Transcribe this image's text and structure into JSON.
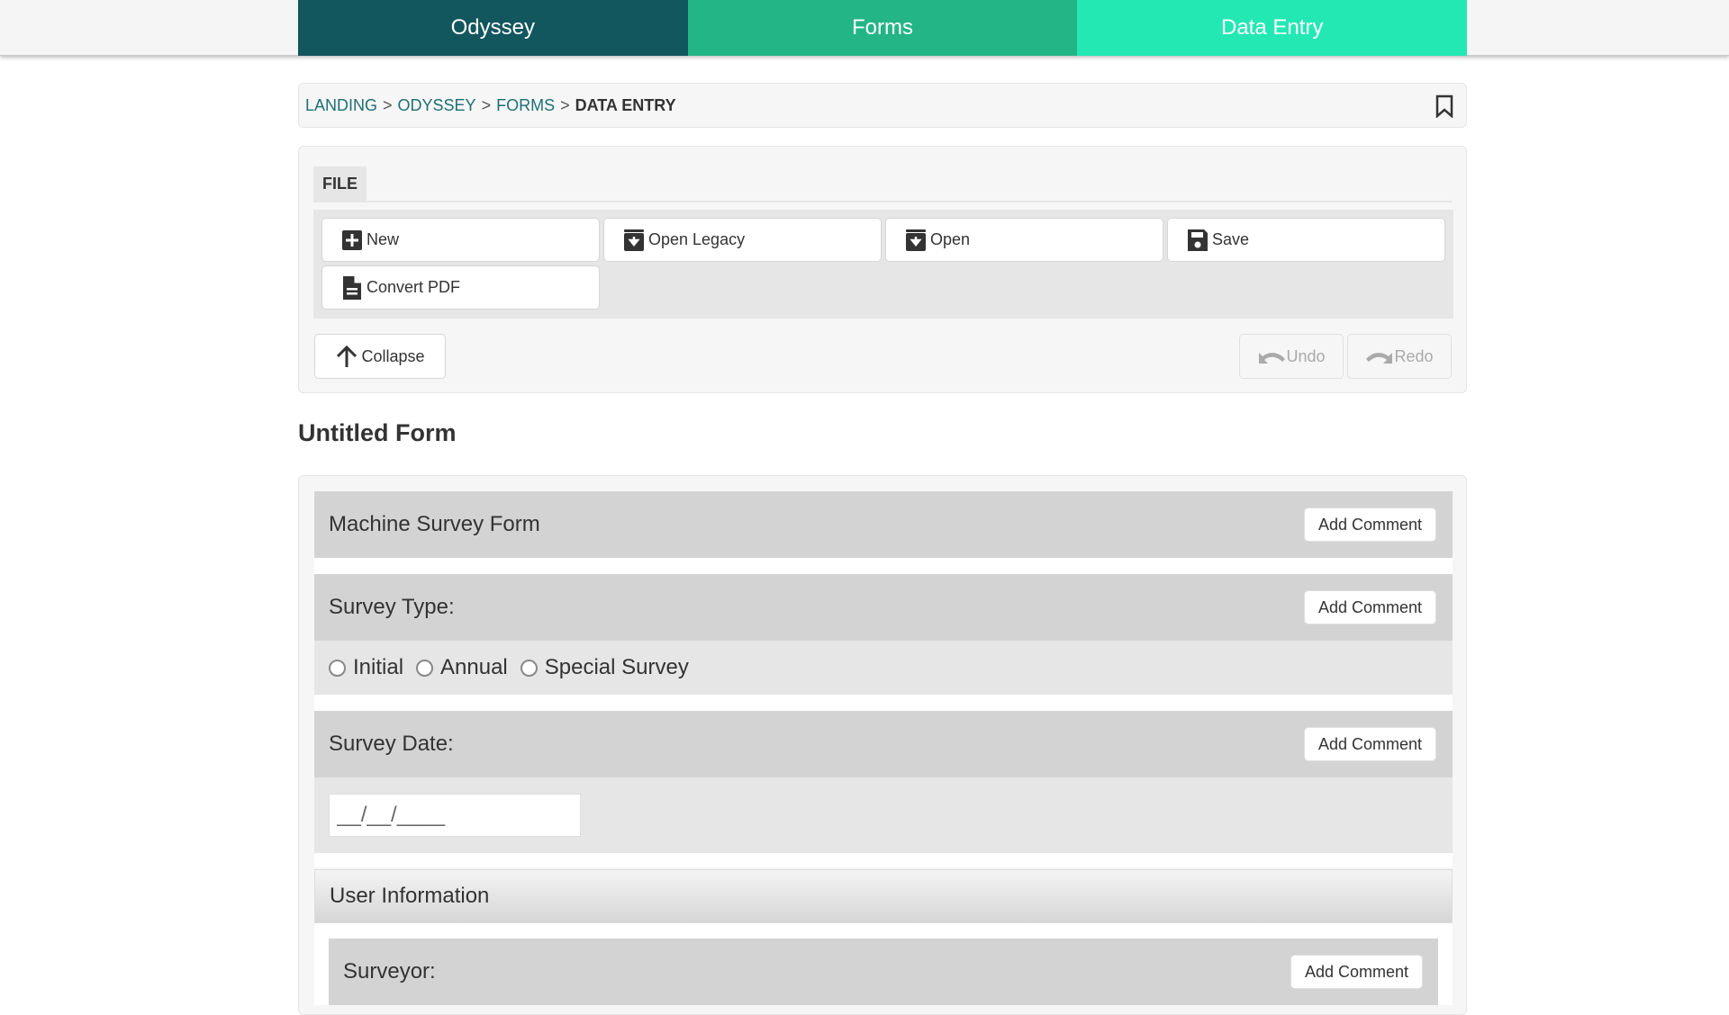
{
  "nav": {
    "tabs": [
      {
        "label": "Odyssey",
        "color": "#12565e"
      },
      {
        "label": "Forms",
        "color": "#24b586"
      },
      {
        "label": "Data Entry",
        "color": "#24e8b4"
      }
    ]
  },
  "breadcrumb": {
    "items": [
      "LANDING",
      "ODYSSEY",
      "FORMS"
    ],
    "separator": ">",
    "current": "DATA ENTRY",
    "bookmark_icon": "bookmark-icon"
  },
  "file_panel": {
    "tab_label": "FILE",
    "buttons": [
      {
        "label": "New",
        "icon": "plus-square-icon"
      },
      {
        "label": "Open Legacy",
        "icon": "archive-download-icon"
      },
      {
        "label": "Open",
        "icon": "archive-download-icon"
      },
      {
        "label": "Save",
        "icon": "floppy-disk-icon"
      },
      {
        "label": "Convert PDF",
        "icon": "document-icon"
      }
    ],
    "collapse_label": "Collapse",
    "undo_label": "Undo",
    "redo_label": "Redo"
  },
  "form": {
    "title": "Untitled Form",
    "add_comment_label": "Add Comment",
    "sections": {
      "machine_survey": {
        "label": "Machine Survey Form"
      },
      "survey_type": {
        "label": "Survey Type:",
        "options": [
          "Initial",
          "Annual",
          "Special Survey"
        ]
      },
      "survey_date": {
        "label": "Survey Date:",
        "placeholder": "__/__/____"
      },
      "user_information": {
        "label": "User Information",
        "surveyor_label": "Surveyor:"
      }
    }
  },
  "colors": {
    "link": "#1f6f74",
    "section_header": "#d3d3d3",
    "section_body": "#e6e6e6"
  }
}
